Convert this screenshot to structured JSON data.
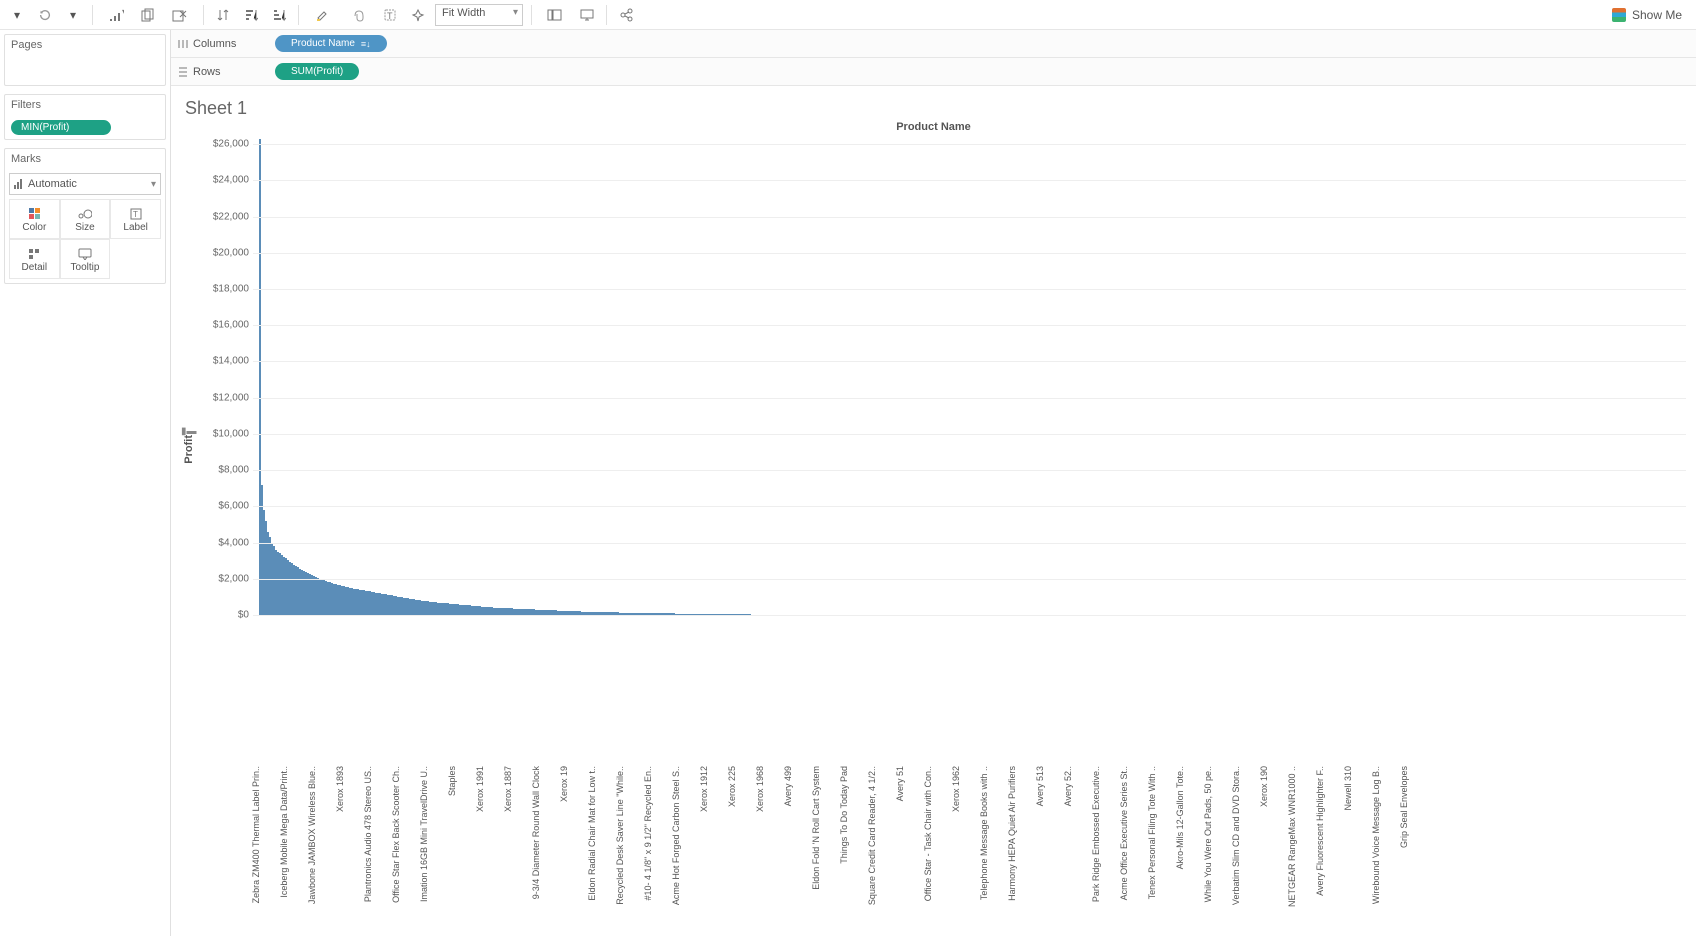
{
  "toolbar": {
    "fit_label": "Fit Width",
    "showme_label": "Show Me"
  },
  "sidebar": {
    "pages_title": "Pages",
    "filters_title": "Filters",
    "filters_pill": "MIN(Profit)",
    "marks_title": "Marks",
    "marks_select": "Automatic",
    "mark_cells": [
      "Color",
      "Size",
      "Label",
      "Detail",
      "Tooltip"
    ]
  },
  "shelves": {
    "columns_label": "Columns",
    "columns_pill": "Product Name",
    "rows_label": "Rows",
    "rows_pill": "SUM(Profit)"
  },
  "viz": {
    "sheet_title": "Sheet 1",
    "x_axis_title": "Product Name",
    "y_axis_title": "Profit"
  },
  "chart_data": {
    "type": "bar",
    "ylabel": "Profit",
    "xlabel": "Product Name",
    "ylim": [
      0,
      26500
    ],
    "yticks": [
      0,
      2000,
      4000,
      6000,
      8000,
      10000,
      12000,
      14000,
      16000,
      18000,
      20000,
      22000,
      24000,
      26000
    ],
    "ytick_labels": [
      "$0",
      "$2,000",
      "$4,000",
      "$6,000",
      "$8,000",
      "$10,000",
      "$12,000",
      "$14,000",
      "$16,000",
      "$18,000",
      "$20,000",
      "$22,000",
      "$24,000",
      "$26,000"
    ],
    "x_tick_every": 14,
    "total_bars": 560,
    "sample_values": [
      26300,
      7200,
      5800,
      5200,
      4600,
      4300,
      4000,
      3800,
      3600,
      3500,
      3400,
      3300,
      3200,
      3150,
      3050,
      2950,
      2850,
      2760,
      2700,
      2640,
      2560,
      2490,
      2420,
      2360,
      2300,
      2250,
      2200,
      2150,
      2100,
      2060,
      2010,
      1960,
      1920,
      1880,
      1840,
      1800,
      1760,
      1730,
      1700,
      1670,
      1640,
      1610,
      1590,
      1560,
      1530,
      1500,
      1480,
      1460,
      1440,
      1420,
      1400,
      1380,
      1360,
      1340,
      1320,
      1300,
      1280,
      1260,
      1240,
      1220,
      1200,
      1180,
      1160,
      1140,
      1120,
      1100,
      1080,
      1060,
      1040,
      1020,
      1000,
      980,
      960,
      940,
      920,
      900,
      880,
      860,
      840,
      825,
      810,
      795,
      780,
      765,
      750,
      735,
      720,
      710,
      700,
      690,
      680,
      670,
      660,
      650,
      640,
      630,
      620,
      610,
      600,
      590,
      580,
      570,
      560,
      550,
      540,
      530,
      520,
      510,
      500,
      490,
      480,
      470,
      460,
      450,
      440,
      430,
      420,
      410,
      400,
      395,
      390,
      385,
      380,
      375,
      370,
      365,
      360,
      355,
      350,
      345,
      340,
      335,
      330,
      325,
      320,
      315,
      310,
      305,
      300,
      295,
      290,
      285,
      280,
      275,
      270,
      265,
      260,
      255,
      250,
      245,
      240,
      235,
      230,
      225,
      220,
      216,
      212,
      208,
      204,
      200,
      197,
      194,
      191,
      188,
      185,
      182,
      179,
      176,
      173,
      170,
      167,
      164,
      161,
      158,
      155,
      152,
      149,
      146,
      143,
      140,
      138,
      136,
      134,
      132,
      130,
      128,
      126,
      124,
      122,
      120,
      118,
      116,
      114,
      112,
      110,
      108,
      106,
      104,
      102,
      100,
      98,
      96,
      94,
      92,
      90,
      88,
      86,
      84,
      82,
      80,
      78,
      76,
      74,
      72,
      70,
      68,
      66,
      64,
      62,
      60,
      58,
      56,
      54,
      52,
      50,
      49,
      48,
      47,
      46,
      45,
      44,
      43,
      42,
      41,
      40,
      39,
      38,
      37,
      36,
      35,
      34,
      33,
      32,
      31,
      30,
      29,
      28,
      27,
      26,
      25,
      24,
      23,
      22,
      21,
      20,
      19,
      18,
      17,
      16,
      15,
      14,
      13,
      12,
      11,
      10,
      10,
      9,
      9,
      8,
      8,
      7,
      7,
      6,
      6,
      5,
      5,
      5,
      4,
      4,
      4,
      4,
      3,
      3,
      3,
      3,
      3,
      2,
      2,
      2,
      2,
      2,
      2,
      2,
      2,
      2,
      2,
      1,
      1,
      1,
      1,
      1,
      1,
      1,
      1,
      1,
      1,
      1,
      1,
      1,
      1,
      1,
      1,
      1,
      1,
      1,
      1,
      1,
      1,
      1,
      1,
      1,
      1,
      1,
      1,
      1,
      1,
      1,
      1,
      1,
      1,
      1,
      1,
      1,
      1,
      1,
      1,
      1,
      1,
      1,
      1,
      0,
      0,
      0,
      0,
      0,
      0,
      0,
      0,
      0,
      0,
      0,
      0,
      0,
      0,
      0,
      0,
      0,
      0,
      0,
      0,
      0,
      0,
      0,
      0,
      0,
      0,
      0,
      0,
      0,
      0,
      0,
      0,
      0,
      0,
      0,
      0,
      0,
      0,
      0,
      0,
      0,
      0,
      0,
      0,
      0,
      0,
      0,
      0,
      0,
      0,
      0,
      0,
      0,
      0,
      0,
      0,
      0,
      0,
      0,
      0,
      0,
      0,
      0,
      0,
      0,
      0,
      0,
      0,
      0,
      0,
      0,
      0,
      0,
      0,
      0,
      0,
      0,
      0,
      0,
      0,
      0,
      0,
      0,
      0,
      0,
      0,
      0,
      0,
      0,
      0,
      0,
      0,
      0,
      0,
      0,
      0,
      0,
      0,
      0,
      0,
      0,
      0,
      0,
      0,
      0,
      0,
      0,
      0,
      0,
      0,
      0,
      0,
      0,
      0,
      0,
      0,
      0,
      0,
      0,
      0,
      0,
      0,
      0,
      0,
      0,
      0,
      0,
      0,
      0,
      0,
      0,
      0,
      0,
      0,
      0,
      0,
      0,
      0,
      0,
      0,
      0,
      0,
      0,
      0,
      0,
      0,
      0,
      0,
      0,
      0,
      0,
      0,
      0,
      0,
      0,
      0,
      0,
      0,
      0,
      0,
      0,
      0,
      0,
      0,
      0,
      0,
      0,
      0,
      0,
      0,
      0,
      0,
      0,
      0,
      0,
      0,
      0,
      0,
      0,
      0,
      0,
      0,
      0,
      0,
      0,
      0,
      0,
      0,
      0,
      0,
      0,
      0,
      0,
      0,
      0,
      0
    ],
    "category_ticks": [
      "Zebra ZM400 Thermal Label Prin..",
      "Iceberg Mobile Mega Data/Print..",
      "Jawbone JAMBOX Wireless Blue..",
      "Xerox 1893",
      "Plantronics Audio 478 Stereo US..",
      "Office Star Flex Back Scooter Ch..",
      "Imation 16GB Mini TravelDrive U..",
      "Staples",
      "Xerox 1991",
      "Xerox 1887",
      "9-3/4 Diameter Round Wall Clock",
      "Xerox 19",
      "Eldon Radial Chair Mat for Low t..",
      "Recycled Desk Saver Line \"While..",
      "#10- 4 1/8\" x 9 1/2\" Recycled En..",
      "Acme Hot Forged Carbon Steel S..",
      "Xerox 1912",
      "Xerox 225",
      "Xerox 1968",
      "Avery 499",
      "Eldon Fold 'N Roll Cart System",
      "Things To Do Today Pad",
      "Square Credit Card Reader, 4 1/2..",
      "Avery 51",
      "Office Star - Task Chair with Con..",
      "Xerox 1962",
      "Telephone Message Books with ..",
      "Harmony HEPA Quiet Air Purifiers",
      "Avery 513",
      "Avery 52..",
      "Park Ridge Embossed Executive..",
      "Acme Office Executive Series St..",
      "Tenex Personal Filing Tote With ..",
      "Akro-Mils 12-Gallon Tote..",
      "While You Were Out Pads, 50 pe..",
      "Verbatim Slim CD and DVD Stora..",
      "Xerox 190",
      "NETGEAR RangeMax WNR1000 ..",
      "Avery Fluorescent Highlighter F..",
      "Newell 310",
      "Wirebound Voice Message Log B..",
      "Grip Seal Envelopes"
    ]
  }
}
